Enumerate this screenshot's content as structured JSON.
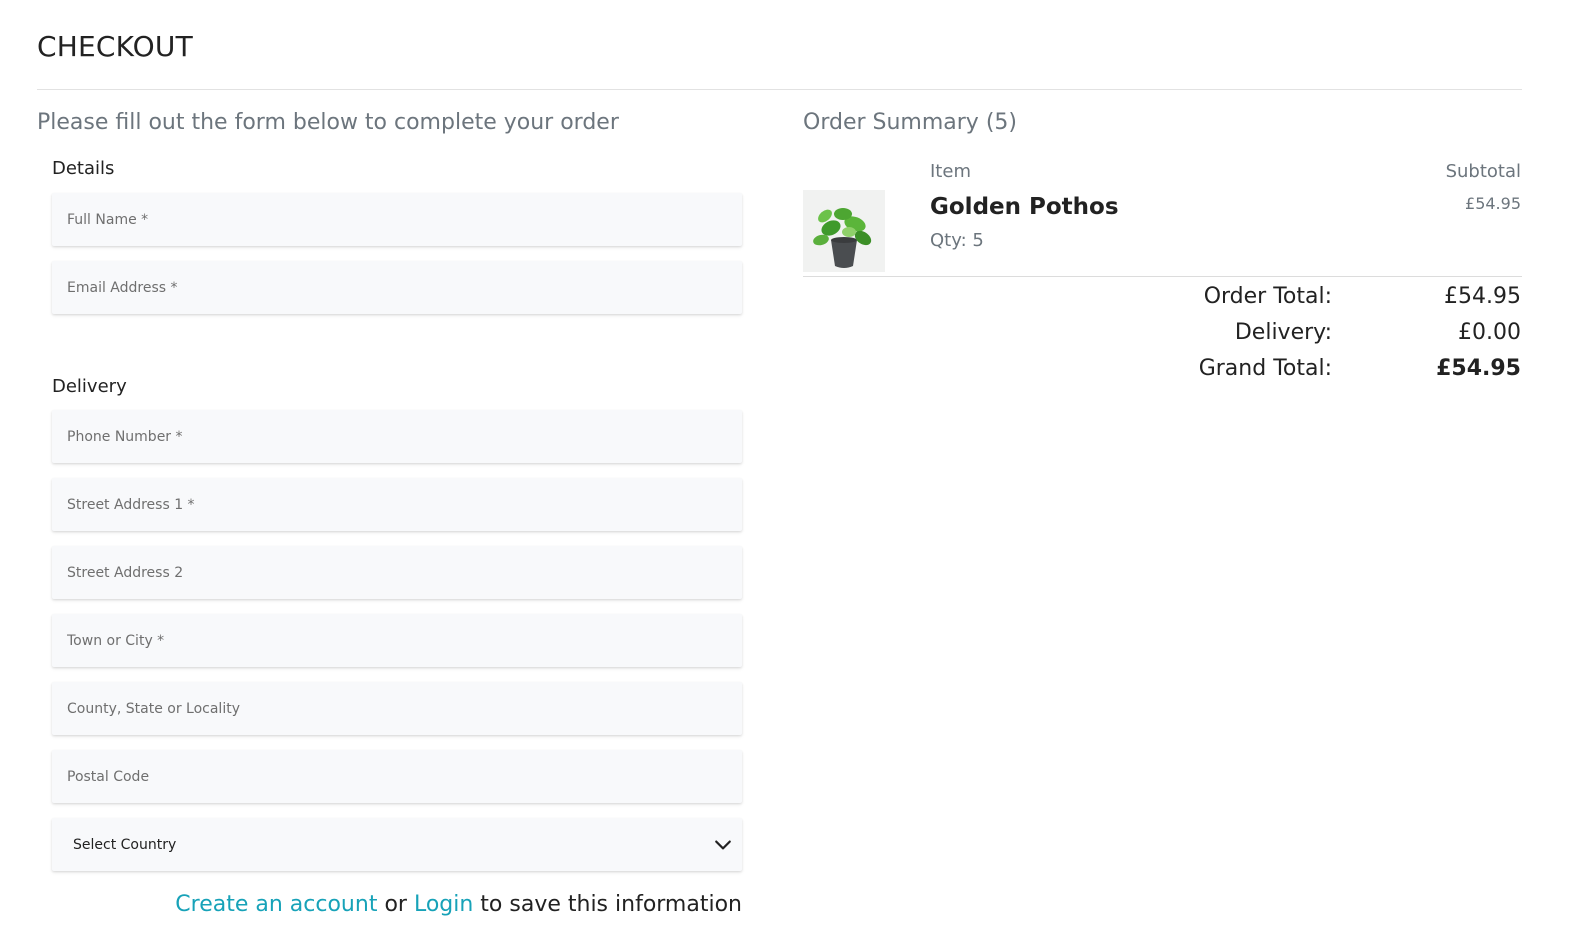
{
  "page": {
    "title": "CHECKOUT",
    "intro": "Please fill out the form below to complete your order"
  },
  "form": {
    "details_label": "Details",
    "delivery_label": "Delivery",
    "full_name": {
      "placeholder": "Full Name *",
      "value": ""
    },
    "email": {
      "placeholder": "Email Address *",
      "value": ""
    },
    "phone": {
      "placeholder": "Phone Number *",
      "value": ""
    },
    "street1": {
      "placeholder": "Street Address 1 *",
      "value": ""
    },
    "street2": {
      "placeholder": "Street Address 2",
      "value": ""
    },
    "town": {
      "placeholder": "Town or City *",
      "value": ""
    },
    "county": {
      "placeholder": "County, State or Locality",
      "value": ""
    },
    "postcode": {
      "placeholder": "Postal Code",
      "value": ""
    },
    "country": {
      "selected": "Select Country",
      "icon": "chevron-down-icon"
    }
  },
  "account": {
    "create_link": "Create an account",
    "or_text": " or ",
    "login_link": "Login",
    "suffix": " to save this information",
    "link_color": "#17a2b8"
  },
  "summary": {
    "heading": "Order Summary (5)",
    "col_item": "Item",
    "col_subtotal": "Subtotal",
    "items": [
      {
        "name": "Golden Pothos",
        "qty": "Qty: 5",
        "subtotal": "£54.95",
        "image": "potted-plant-image"
      }
    ],
    "order_total_label": "Order Total:",
    "order_total_value": "£54.95",
    "delivery_label": "Delivery:",
    "delivery_value": "£0.00",
    "grand_total_label": "Grand Total:",
    "grand_total_value": "£54.95"
  }
}
